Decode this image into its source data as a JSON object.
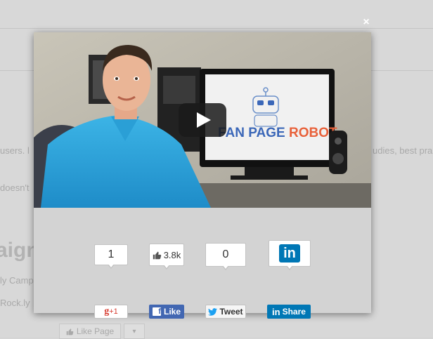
{
  "background": {
    "text_users": "users. l",
    "text_studies": "udies, best pra",
    "text_doesnt": "doesn't",
    "heading": "aign",
    "text_campaign": "ly Camp",
    "text_rocklv": "Rock.ly",
    "like_page_label": "Like Page"
  },
  "modal": {
    "close_symbol": "×",
    "video": {
      "brand_name_part1": "FAN PAGE ",
      "brand_name_part2": "ROBOT"
    },
    "share": {
      "gplus": {
        "count": "1",
        "label": "+1",
        "mark": "g"
      },
      "facebook": {
        "count": "3.8k",
        "label": "Like",
        "mark": "f"
      },
      "twitter": {
        "count": "0",
        "label": "Tweet"
      },
      "linkedin": {
        "logo": "in",
        "mark": "in",
        "label": "Share"
      }
    }
  },
  "colors": {
    "facebook": "#4267b2",
    "linkedin": "#0077b5",
    "twitter": "#1da1f2",
    "gplus": "#d73d32"
  }
}
